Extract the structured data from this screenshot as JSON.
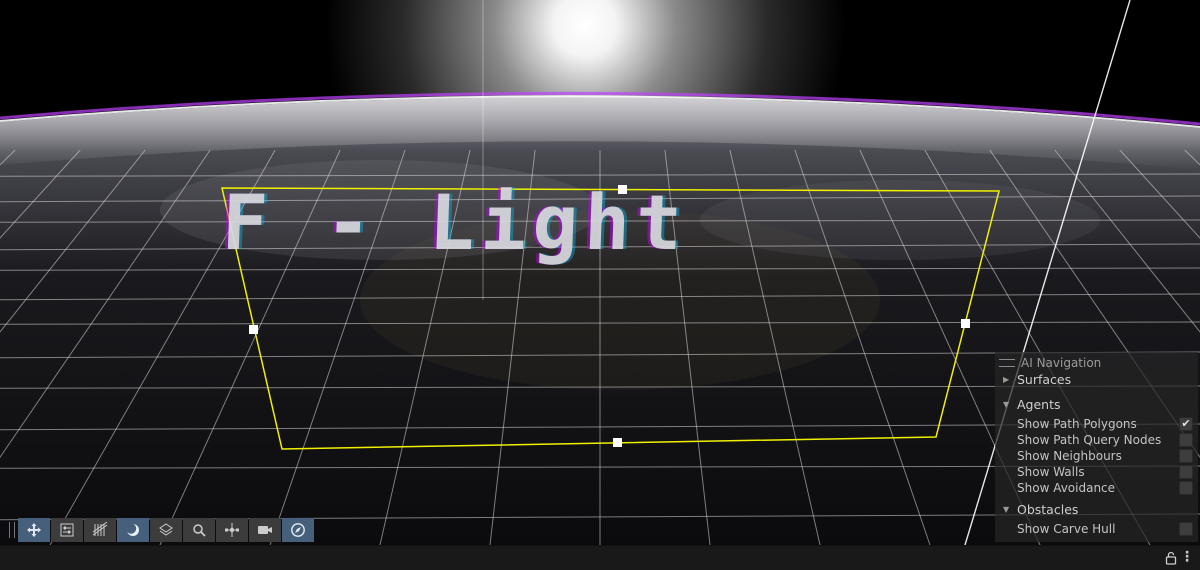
{
  "scene": {
    "world_text": "F - Light"
  },
  "overlay": {
    "title": "AI Navigation",
    "sections": {
      "surfaces": "Surfaces",
      "agents": "Agents",
      "obstacles": "Obstacles"
    },
    "agents_options": [
      {
        "label": "Show Path Polygons",
        "checked": true
      },
      {
        "label": "Show Path Query Nodes",
        "checked": false
      },
      {
        "label": "Show Neighbours",
        "checked": false
      },
      {
        "label": "Show Walls",
        "checked": false
      },
      {
        "label": "Show Avoidance",
        "checked": false
      }
    ],
    "obstacles_options": [
      {
        "label": "Show Carve Hull",
        "checked": false
      }
    ],
    "check_glyph": "✔"
  },
  "toolbar": {
    "tools": [
      {
        "icon": "move-view-icon",
        "active": true
      },
      {
        "icon": "sliders-icon",
        "active": false
      },
      {
        "icon": "grid-hatch-icon",
        "active": false
      },
      {
        "icon": "moon-icon",
        "active": true
      },
      {
        "icon": "layers-icon",
        "active": false
      },
      {
        "icon": "search-icon",
        "active": false
      },
      {
        "icon": "transform-gizmo-icon",
        "active": false
      },
      {
        "icon": "camera-visibility-icon",
        "active": false
      },
      {
        "icon": "compass-icon",
        "active": true
      }
    ]
  },
  "statusbar": {
    "icons": [
      "lock-icon",
      "more-vertical-icon"
    ]
  },
  "colors": {
    "selection": "#f0f000",
    "panel_bg": "#262626",
    "toolbar_active": "#46607c",
    "toolbar_bg": "#3c3c3c",
    "statusbar_bg": "#191919"
  }
}
